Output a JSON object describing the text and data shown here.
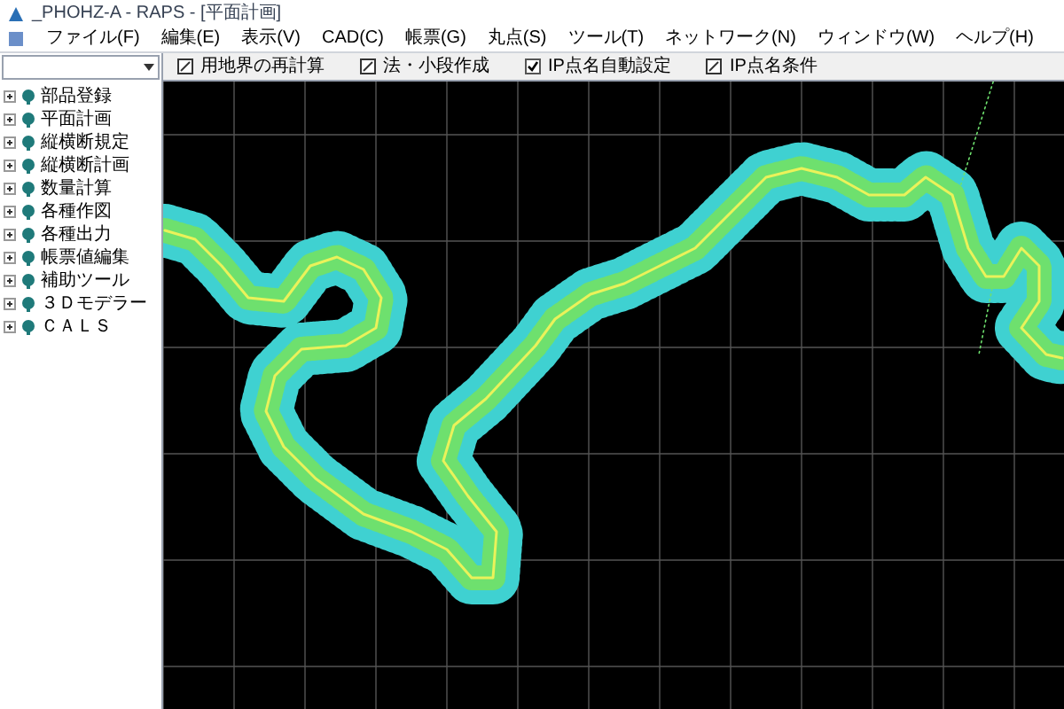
{
  "window": {
    "title": "_PHOHZ-A - RAPS - [平面計画]"
  },
  "menu": [
    "ファイル(F)",
    "編集(E)",
    "表示(V)",
    "CAD(C)",
    "帳票(G)",
    "丸点(S)",
    "ツール(T)",
    "ネットワーク(N)",
    "ウィンドウ(W)",
    "ヘルプ(H)"
  ],
  "toolbar": [
    {
      "kind": "button",
      "label": "用地界の再計算"
    },
    {
      "kind": "button",
      "label": "法・小段作成"
    },
    {
      "kind": "checkbox",
      "label": "IP点名自動設定",
      "checked": true
    },
    {
      "kind": "button",
      "label": "IP点名条件"
    }
  ],
  "sidebar": {
    "items": [
      {
        "label": "部品登録",
        "expanded": false
      },
      {
        "label": "平面計画",
        "expanded": false
      },
      {
        "label": "縦横断規定",
        "expanded": false
      },
      {
        "label": "縦横断計画",
        "expanded": false
      },
      {
        "label": "数量計算",
        "expanded": false
      },
      {
        "label": "各種作図",
        "expanded": false
      },
      {
        "label": "各種出力",
        "expanded": false
      },
      {
        "label": "帳票値編集",
        "expanded": false
      },
      {
        "label": "補助ツール",
        "expanded": false
      },
      {
        "label": "３Ｄモデラー",
        "expanded": false
      },
      {
        "label": "ＣＡＬＳ",
        "expanded": false
      }
    ]
  }
}
